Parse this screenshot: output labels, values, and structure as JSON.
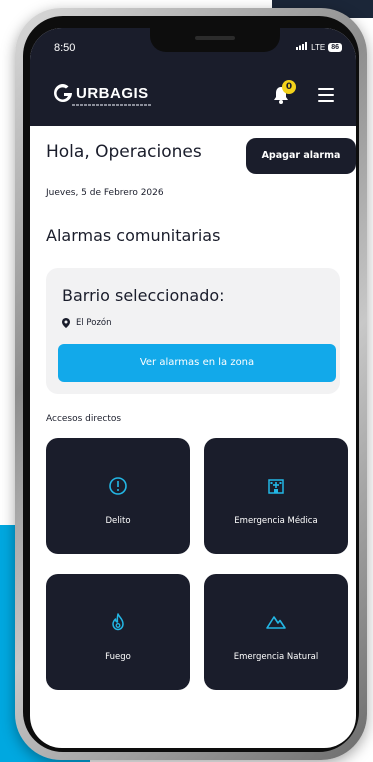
{
  "status_bar": {
    "time": "8:50",
    "network": "LTE",
    "battery": "86"
  },
  "header": {
    "logo_text": "URBAGIS",
    "notification_count": "0"
  },
  "greeting": "Hola, Operaciones",
  "off_button_label": "Apagar alarma",
  "date": "Jueves, 5 de Febrero 2026",
  "section_title": "Alarmas comunitarias",
  "card": {
    "title": "Barrio seleccionado:",
    "location": "El Pozón",
    "button_label": "Ver alarmas en la zona"
  },
  "shortcuts": {
    "label": "Accesos directos",
    "items": [
      {
        "label": "Delito",
        "icon": "alert-circle-icon"
      },
      {
        "label": "Emergencia Médica",
        "icon": "hospital-icon"
      },
      {
        "label": "Fuego",
        "icon": "fire-icon"
      },
      {
        "label": "Emergencia Natural",
        "icon": "mountain-icon"
      }
    ]
  },
  "colors": {
    "header_bg": "#1a1d2b",
    "accent_blue": "#12a9ea",
    "icon_cyan": "#23b7e5",
    "badge_yellow": "#f3d21b"
  }
}
